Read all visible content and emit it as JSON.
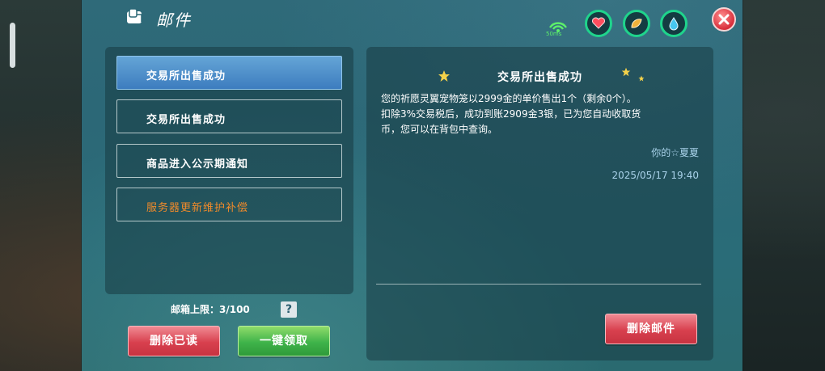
{
  "window": {
    "title": "邮件"
  },
  "status": {
    "signal_text": "50ms"
  },
  "mail_list": {
    "items": [
      {
        "label": "交易所出售成功",
        "active": true
      },
      {
        "label": "交易所出售成功",
        "active": false
      },
      {
        "label": "商品进入公示期通知",
        "active": false
      },
      {
        "label": "服务器更新维护补偿",
        "active": false
      }
    ]
  },
  "footer": {
    "limit_text": "邮箱上限：3/100",
    "help_label": "?",
    "delete_read_label": "删除已读",
    "collect_all_label": "一键领取"
  },
  "detail": {
    "title": "交易所出售成功",
    "body_lines": [
      "您的祈愿灵翼宠物笼以2999金的单价售出1个（剩余0个）。",
      "扣除3%交易税后，成功到账2909金3银，已为您自动收取货",
      "币，您可以在背包中查询。"
    ],
    "sender": "你的☆夏夏",
    "date": "2025/05/17 19:40",
    "delete_label": "删除邮件"
  },
  "colors": {
    "accent_red": "#d8404e",
    "accent_green": "#3fb34a",
    "active_item": "#3d7dbf",
    "warning_text": "#f08a2a",
    "meta_text": "#a9d2ea"
  }
}
